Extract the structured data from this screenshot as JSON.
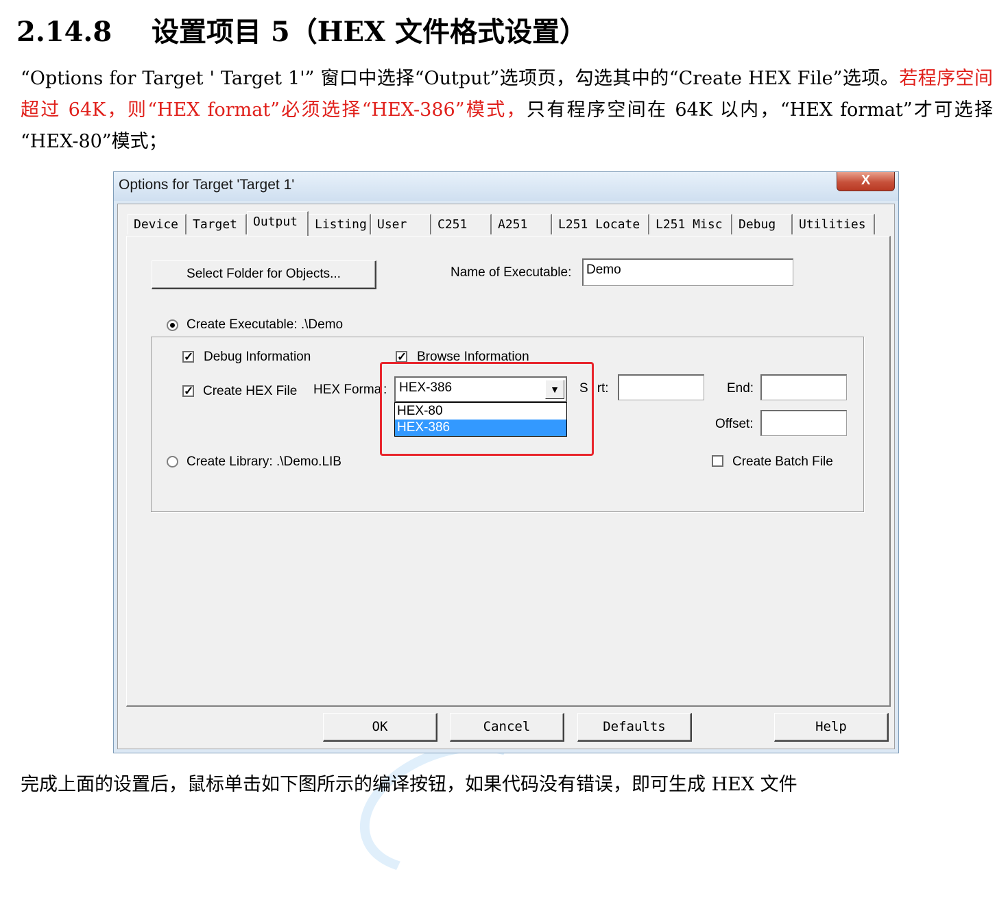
{
  "document": {
    "heading_number": "2.14.8",
    "heading_title": "设置项目 5（HEX 文件格式设置）",
    "para_part1": "“Options for Target ' Target 1'” 窗口中选择“Output”选项页，勾选其中的“Create HEX File”选项。",
    "para_red": "若程序空间超过 64K，则“HEX format”必须选择“HEX-386”模式，",
    "para_part2": "只有程序空间在 64K 以内，“HEX format”才可选择 “HEX-80”模式；",
    "footer": "完成上面的设置后，鼠标单击如下图所示的编译按钮，如果代码没有错误，即可生成 HEX 文件"
  },
  "dialog": {
    "title": "Options for Target 'Target 1'",
    "close_label": "X",
    "tabs": [
      {
        "label": "Device"
      },
      {
        "label": "Target"
      },
      {
        "label": "Output"
      },
      {
        "label": "Listing"
      },
      {
        "label": "User"
      },
      {
        "label": "C251"
      },
      {
        "label": "A251"
      },
      {
        "label": "L251 Locate"
      },
      {
        "label": "L251 Misc"
      },
      {
        "label": "Debug"
      },
      {
        "label": "Utilities"
      }
    ],
    "active_tab": "Output",
    "output": {
      "select_folder_label": "Select Folder for Objects...",
      "name_exec_label": "Name of Executable:",
      "name_exec_value": "Demo",
      "create_exec_label": "Create Executable:  .\\Demo",
      "create_exec_selected": true,
      "debug_info_label": "Debug Information",
      "debug_info_checked": true,
      "browse_info_label": "Browse Information",
      "browse_info_checked": true,
      "create_hex_label": "Create HEX File",
      "create_hex_checked": true,
      "hex_format_label": "HEX Forma",
      "hex_format_colon": ":",
      "hex_format_value": "HEX-386",
      "hex_format_options": [
        "HEX-80",
        "HEX-386"
      ],
      "hex_format_selected_index": 1,
      "start_label_a": "S",
      "start_label_b": "rt:",
      "start_value": "",
      "end_label": "End:",
      "end_value": "",
      "offset_label": "Offset:",
      "offset_value": "",
      "create_library_label": "Create Library:  .\\Demo.LIB",
      "create_library_selected": false,
      "batch_label": "Create Batch File",
      "batch_checked": false
    },
    "buttons": {
      "ok": "OK",
      "cancel": "Cancel",
      "defaults": "Defaults",
      "help": "Help"
    },
    "highlight_color": "#e8262d",
    "selection_color": "#3399ff"
  }
}
